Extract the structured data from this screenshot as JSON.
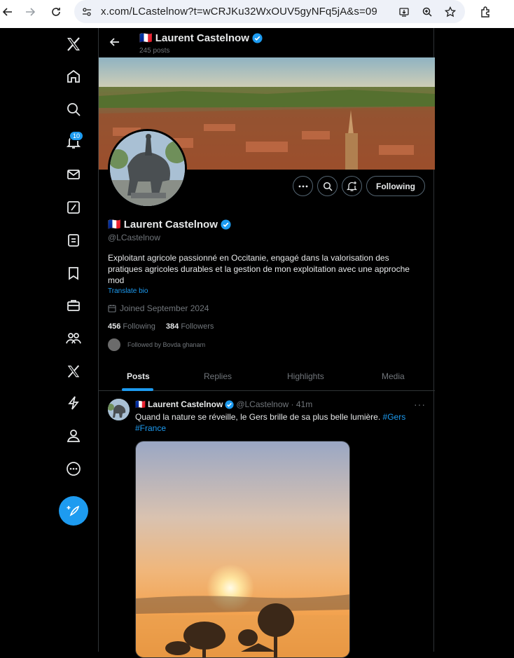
{
  "browser": {
    "url": "x.com/LCastelnow?t=wCRJKu32WxOUV5gyNFq5jA&s=09"
  },
  "nav": {
    "notification_count": "10"
  },
  "profile": {
    "flag": "🇫🇷",
    "display_name": "Laurent Castelnow",
    "post_count": "245 posts",
    "handle": "@LCastelnow",
    "bio": "Exploitant agricole passionné en Occitanie, engagé dans la valorisation des pratiques agricoles durables et la gestion de mon exploitation avec une approche mod",
    "translate_label": "Translate bio",
    "joined": "Joined September 2024",
    "following_count": "456",
    "following_label": "Following",
    "followers_count": "384",
    "followers_label": "Followers",
    "followed_by": "Followed by Bovda ghanam",
    "follow_button_label": "Following"
  },
  "tabs": [
    {
      "label": "Posts",
      "active": true
    },
    {
      "label": "Replies",
      "active": false
    },
    {
      "label": "Highlights",
      "active": false
    },
    {
      "label": "Media",
      "active": false
    }
  ],
  "tweet": {
    "flag": "🇫🇷",
    "name": "Laurent Castelnow",
    "handle_time": "@LCastelnow · 41m",
    "text": "Quand la nature se réveille, le Gers brille de sa plus belle lumière.",
    "hashtag1": "#Gers",
    "hashtag2": "#France",
    "more": "···"
  },
  "colors": {
    "accent": "#1d9bf0",
    "text_primary": "#e7e9ea",
    "text_secondary": "#71767b",
    "border": "#2f3336"
  }
}
